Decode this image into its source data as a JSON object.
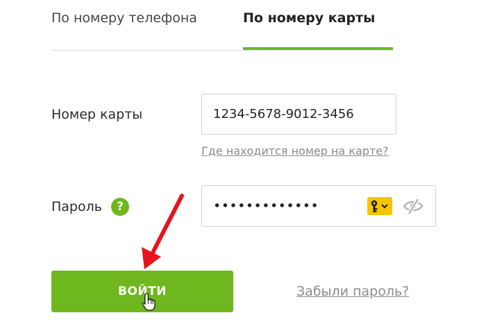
{
  "tabs": {
    "phone_label": "По номеру телефона",
    "card_label": "По номеру карты",
    "active": "card"
  },
  "card_field": {
    "label": "Номер карты",
    "value": "1234-5678-9012-3456",
    "help_link": "Где находится номер на карте?"
  },
  "password_field": {
    "label": "Пароль",
    "help_icon": "?",
    "value": "•••••••••••••",
    "key_icon": "key-icon",
    "eye_icon": "eye-off-icon"
  },
  "actions": {
    "login_label": "ВОЙТИ",
    "forgot_label": "Забыли пароль?"
  },
  "colors": {
    "accent": "#6fb71f",
    "key_badge": "#f6c500",
    "annotation_arrow": "#e8141d",
    "link": "#8a8a8a"
  }
}
